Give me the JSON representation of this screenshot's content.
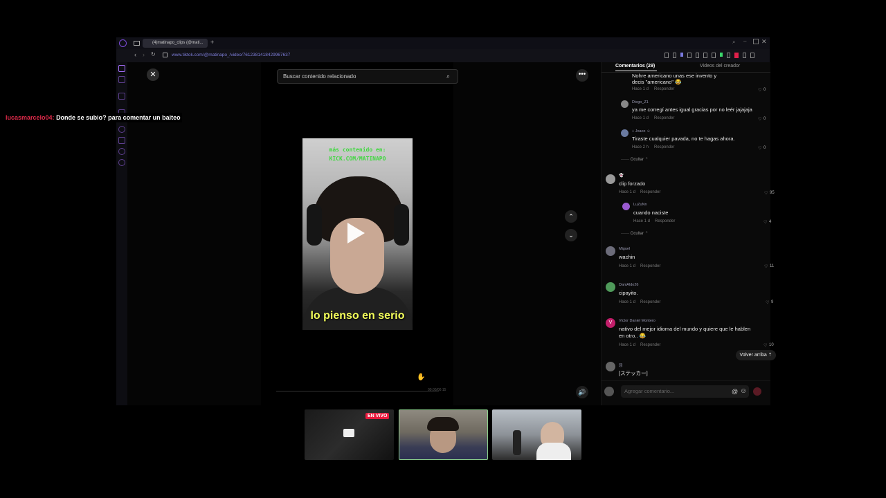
{
  "browser": {
    "tab_title": "(4)matinapo_clips (@mati...",
    "url": "www.tiktok.com/@matinapo_/video/7612381418429967637"
  },
  "video": {
    "search_placeholder": "Buscar contenido relacionado",
    "overlay_line1": "más contenido en:",
    "overlay_line2": "KICK.COM/MATINAPO",
    "caption": "lo pienso en serio",
    "timer": "00:00/00:15"
  },
  "panel": {
    "tab_comments": "Comentarios (29)",
    "tab_creator": "Videos del creador",
    "comments": [
      {
        "user": "",
        "text": "Nohre americano  unas ese invento y decis \"americano\" 😂",
        "time": "Hace 1 d",
        "reply": "Responder",
        "likes": "0",
        "nested": true
      },
      {
        "user": "Diego_Z1",
        "text": "ya me corregí antes igual gracias por no leér jajajaja",
        "time": "Hace 1 d",
        "reply": "Responder",
        "likes": "0",
        "nested": true
      },
      {
        "user": "+ Joaco ☺",
        "text": "Tiraste cualquier pavada, no te hagas ahora.",
        "time": "Hace 2 h",
        "reply": "Responder",
        "likes": "0",
        "nested": true
      },
      {
        "user": "👻",
        "text": "clip forzado",
        "time": "Hace 1 d",
        "reply": "Responder",
        "likes": "95",
        "nested": false
      },
      {
        "user": "LuZuNn",
        "text": "cuando naciste",
        "time": "Hace 1 d",
        "reply": "Responder",
        "likes": "4",
        "nested": true
      },
      {
        "user": "Miguel",
        "text": "wachin",
        "time": "Hace 1 d",
        "reply": "Responder",
        "likes": "11",
        "nested": false
      },
      {
        "user": "DaniAldo26",
        "text": "cipayito.",
        "time": "Hace 1 d",
        "reply": "Responder",
        "likes": "9",
        "nested": false
      },
      {
        "user": "Victor Daniel Montero",
        "text": "nativo del mejor idioma del mundo y quiere que le hablen",
        "text2": "en otro.. 😂",
        "time": "Hace 1 d",
        "reply": "Responder",
        "likes": "10",
        "nested": false
      },
      {
        "user": "怨",
        "text": "[ステッカー]",
        "time": "",
        "reply": "",
        "likes": "",
        "nested": false
      }
    ],
    "hide_label": "Ocultar",
    "back_to_top": "Volver arriba",
    "comment_placeholder": "Agregar comentario..."
  },
  "chat": {
    "username": "lucasmarcelo04:",
    "message": "Donde se subio? para comentar un baiteo"
  },
  "stream": {
    "live_badge": "EN VIVO"
  },
  "colors": {
    "accent": "#e02a4a",
    "caption": "#f4ff5a",
    "kick_green": "#3fd83f"
  }
}
